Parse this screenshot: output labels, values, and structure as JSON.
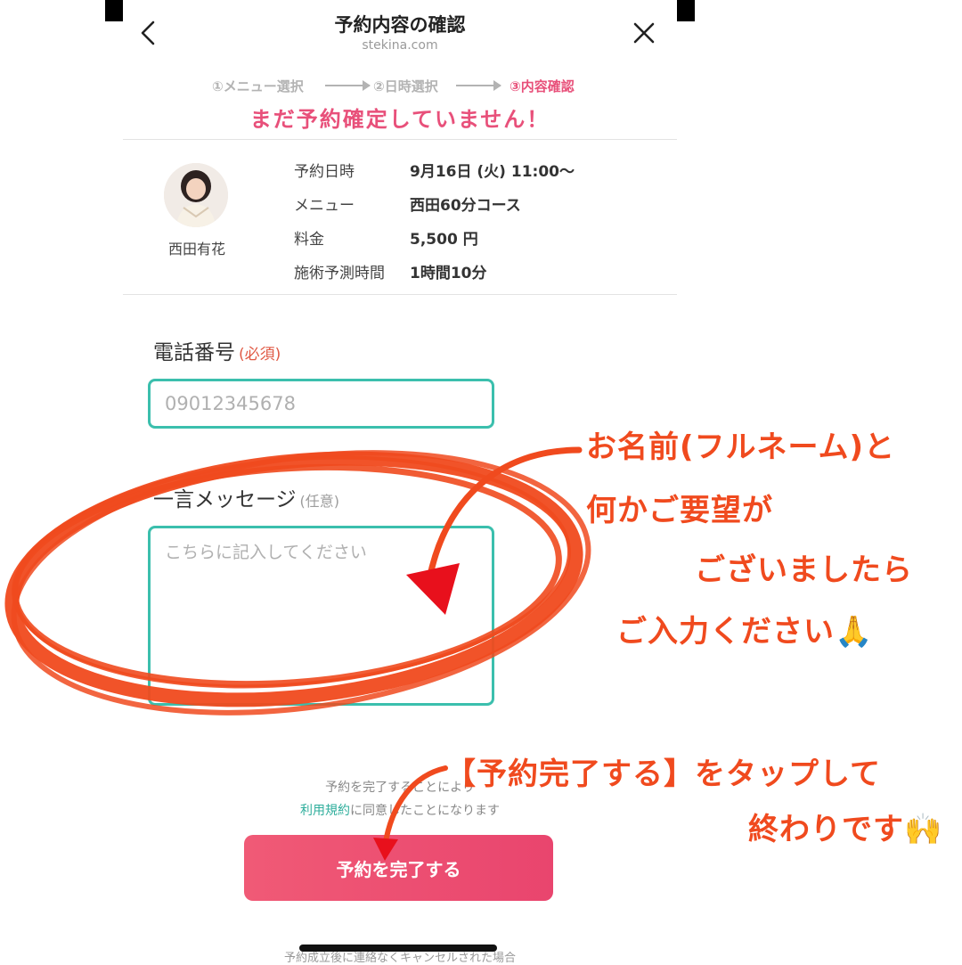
{
  "header": {
    "title": "予約内容の確認",
    "domain": "stekina.com",
    "back_icon": "chevron-left-icon",
    "close_icon": "close-icon"
  },
  "steps": [
    {
      "label": "①メニュー選択",
      "active": false
    },
    {
      "label": "②日時選択",
      "active": false
    },
    {
      "label": "③内容確認",
      "active": true
    }
  ],
  "warning": "まだ予約確定していません！",
  "staff": {
    "name": "西田有花",
    "avatar_icon": "staff-photo"
  },
  "booking": [
    {
      "label": "予約日時",
      "value": "9月16日 (火) 11:00〜"
    },
    {
      "label": "メニュー",
      "value": "西田60分コース"
    },
    {
      "label": "料金",
      "value": "5,500 円"
    },
    {
      "label": "施術予測時間",
      "value": "1時間10分"
    }
  ],
  "form": {
    "phone": {
      "label": "電話番号",
      "required": "(必須)",
      "placeholder": "09012345678"
    },
    "message": {
      "label": "一言メッセージ",
      "optional": "(任意)",
      "placeholder": "こちらに記入してください"
    }
  },
  "terms": {
    "line1": "予約を完了することにより",
    "link": "利用規約",
    "line2_rest": "に同意したことになります"
  },
  "submit_label": "予約を完了する",
  "footer_text": "予約成立後に連絡なくキャンセルされた場合",
  "annotations": {
    "note1": [
      "お名前(フルネーム)と",
      "何かご要望が",
      "ございましたら",
      "ご入力ください🙏"
    ],
    "note2": [
      "【予約完了する】をタップして",
      "終わりです🙌"
    ],
    "color": "#f04a1e"
  },
  "colors": {
    "accent_pink": "#e8507a",
    "teal": "#3bbfad",
    "button": "#ee506f"
  }
}
